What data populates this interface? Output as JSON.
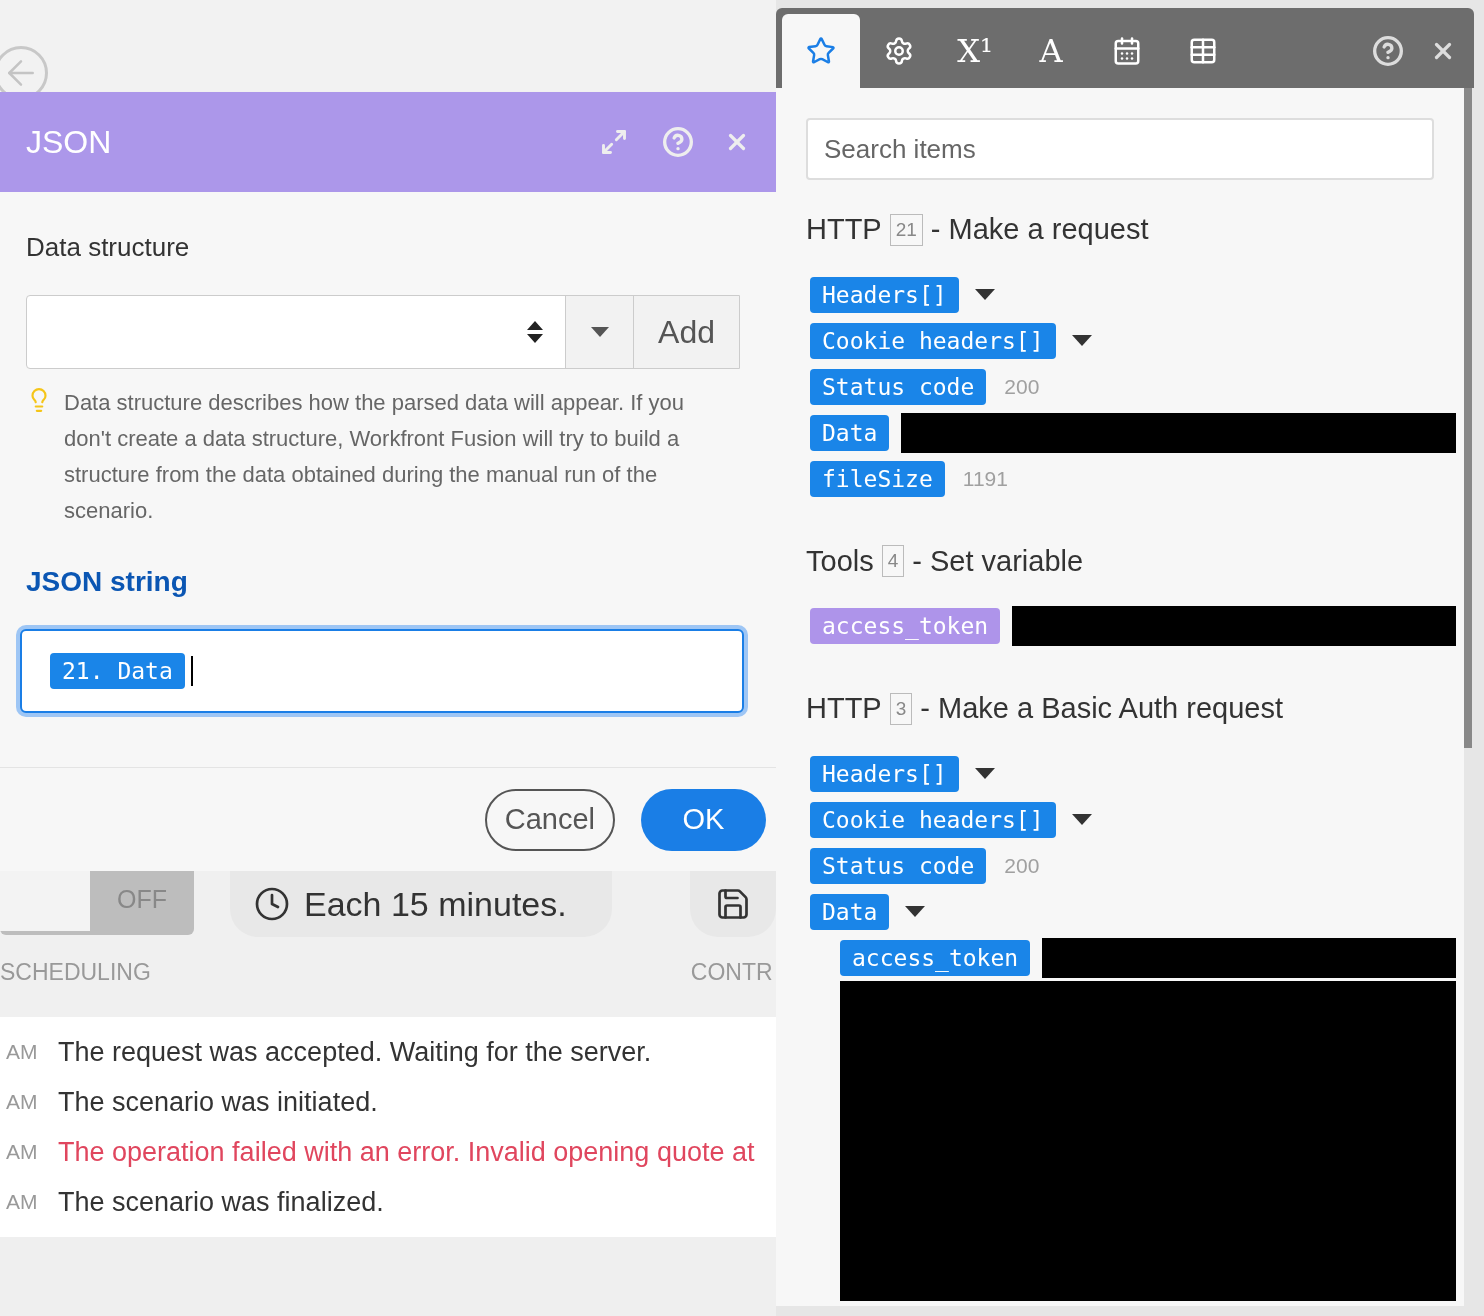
{
  "modal": {
    "title": "JSON",
    "data_structure": {
      "label": "Data structure",
      "add_button": "Add",
      "hint": "Data structure describes how the parsed data will appear. If you don't create a data structure, Workfront Fusion will try to build a structure from the data obtained during the manual run of the scenario."
    },
    "json_string": {
      "label": "JSON string",
      "token": "21. Data"
    },
    "buttons": {
      "cancel": "Cancel",
      "ok": "OK"
    }
  },
  "toolbar": {
    "toggle": "OFF",
    "on": false,
    "schedule": "Each 15 minutes.",
    "labels": [
      "SCHEDULING",
      "CONTR"
    ]
  },
  "log": [
    {
      "time": "AM",
      "message": "The request was accepted. Waiting for the server.",
      "kind": "info"
    },
    {
      "time": "AM",
      "message": "The scenario was initiated.",
      "kind": "info"
    },
    {
      "time": "AM",
      "message": "The operation failed with an error. Invalid opening quote at",
      "kind": "error"
    },
    {
      "time": "AM",
      "message": "The scenario was finalized.",
      "kind": "info"
    }
  ],
  "picker": {
    "tabs": [
      {
        "kind": "star",
        "selected": true
      },
      {
        "kind": "gear",
        "selected": false
      },
      {
        "kind": "glyph",
        "label": "X¹",
        "selected": false
      },
      {
        "kind": "glyph",
        "label": "A",
        "selected": false
      },
      {
        "kind": "calendar",
        "selected": false
      },
      {
        "kind": "table",
        "selected": false
      }
    ],
    "search": {
      "placeholder": "Search items"
    },
    "modules": [
      {
        "app": "HTTP",
        "number": "21",
        "action": "- Make a request",
        "items": [
          {
            "label": "Headers[]",
            "kind": "collapsible",
            "color": "#1a85e8"
          },
          {
            "label": "Cookie headers[]",
            "kind": "collapsible",
            "color": "#1a85e8"
          },
          {
            "label": "Status code",
            "kind": "value",
            "value": "200",
            "color": "#1a85e8"
          },
          {
            "label": "Data",
            "kind": "redacted",
            "color": "#1a85e8"
          },
          {
            "label": "fileSize",
            "kind": "value",
            "value": "1191",
            "color": "#1a85e8"
          }
        ]
      },
      {
        "app": "Tools",
        "number": "4",
        "action": "- Set variable",
        "items": [
          {
            "label": "access_token",
            "kind": "redacted",
            "color": "#ae94ea"
          }
        ]
      },
      {
        "app": "HTTP",
        "number": "3",
        "action": "- Make a Basic Auth request",
        "items": [
          {
            "label": "Headers[]",
            "kind": "collapsible",
            "color": "#1a85e8"
          },
          {
            "label": "Cookie headers[]",
            "kind": "collapsible",
            "color": "#1a85e8"
          },
          {
            "label": "Status code",
            "kind": "value",
            "value": "200",
            "color": "#1a85e8"
          },
          {
            "label": "Data",
            "kind": "expanded",
            "color": "#1a85e8",
            "children": [
              {
                "label": "access_token",
                "kind": "redacted",
                "color": "#1a85e8"
              },
              {
                "kind": "redacted_block"
              }
            ]
          }
        ]
      }
    ]
  }
}
